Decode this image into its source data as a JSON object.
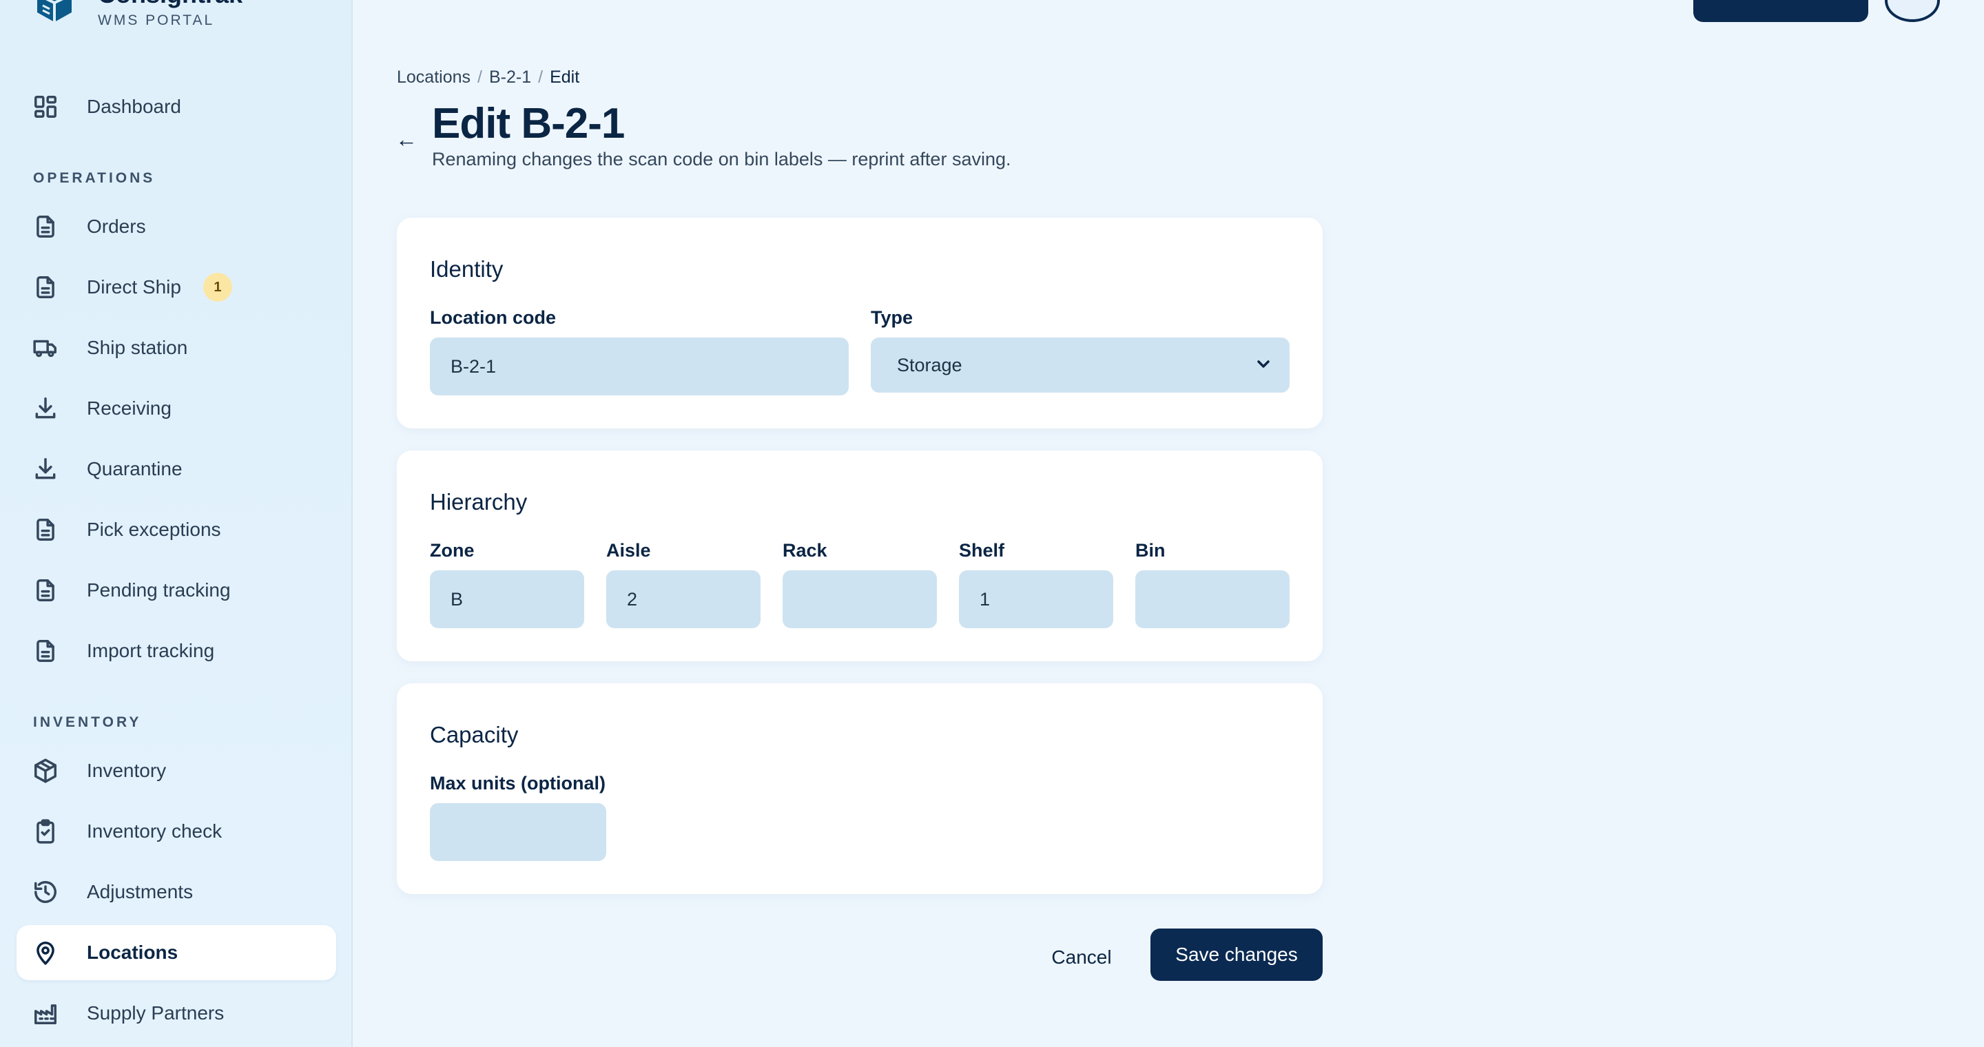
{
  "brand": {
    "name": "Consigntrak",
    "subtitle": "WMS PORTAL"
  },
  "sidebar": {
    "dashboard": "Dashboard",
    "operations_label": "OPERATIONS",
    "operations": [
      {
        "label": "Orders",
        "icon": "document-icon"
      },
      {
        "label": "Direct Ship",
        "icon": "document-icon",
        "badge": "1"
      },
      {
        "label": "Ship station",
        "icon": "truck-icon"
      },
      {
        "label": "Receiving",
        "icon": "download-icon"
      },
      {
        "label": "Quarantine",
        "icon": "download-icon"
      },
      {
        "label": "Pick exceptions",
        "icon": "document-icon"
      },
      {
        "label": "Pending tracking",
        "icon": "document-icon"
      },
      {
        "label": "Import tracking",
        "icon": "document-icon"
      }
    ],
    "inventory_label": "INVENTORY",
    "inventory": [
      {
        "label": "Inventory",
        "icon": "cube-icon"
      },
      {
        "label": "Inventory check",
        "icon": "clipboard-check-icon"
      },
      {
        "label": "Adjustments",
        "icon": "history-icon"
      },
      {
        "label": "Locations",
        "icon": "map-pin-icon",
        "active": true
      },
      {
        "label": "Supply Partners",
        "icon": "factory-icon"
      }
    ]
  },
  "breadcrumb": {
    "root": "Locations",
    "item": "B-2-1",
    "current": "Edit",
    "sep": "/"
  },
  "header": {
    "back": "←",
    "title": "Edit B-2-1",
    "subtitle": "Renaming changes the scan code on bin labels — reprint after saving."
  },
  "identity": {
    "title": "Identity",
    "code_label": "Location code",
    "code_value": "B-2-1",
    "type_label": "Type",
    "type_value": "Storage"
  },
  "hierarchy": {
    "title": "Hierarchy",
    "zone_label": "Zone",
    "zone_value": "B",
    "aisle_label": "Aisle",
    "aisle_value": "2",
    "rack_label": "Rack",
    "rack_value": "",
    "shelf_label": "Shelf",
    "shelf_value": "1",
    "bin_label": "Bin",
    "bin_value": ""
  },
  "capacity": {
    "title": "Capacity",
    "max_label": "Max units (optional)",
    "max_value": ""
  },
  "actions": {
    "cancel": "Cancel",
    "save": "Save changes"
  },
  "colors": {
    "primary": "#0b2a52",
    "field": "#cde3f1",
    "badge": "#fbe6a4"
  }
}
